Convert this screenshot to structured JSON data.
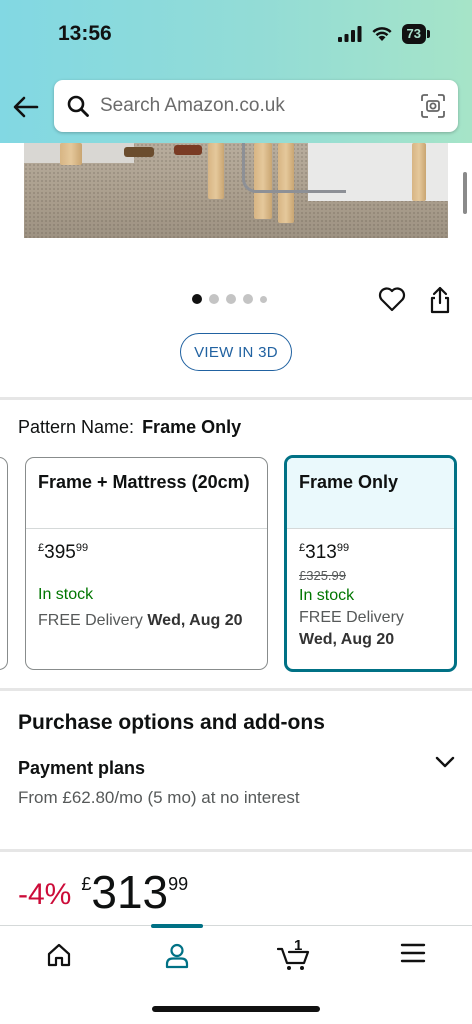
{
  "status_bar": {
    "time": "13:56",
    "battery": "73"
  },
  "search": {
    "placeholder": "Search Amazon.co.uk"
  },
  "gallery": {
    "dots": 5,
    "active_index": 0
  },
  "view3d_label": "VIEW IN 3D",
  "pattern": {
    "label": "Pattern Name:",
    "value": "Frame Only"
  },
  "options": [
    {
      "title": "Frame + Mattress (20cm)",
      "currency": "£",
      "price_whole": "395",
      "price_frac": "99",
      "stock": "In stock",
      "delivery_prefix": "FREE Delivery",
      "delivery_date": "Wed, Aug 20"
    },
    {
      "title": "Frame Only",
      "currency": "£",
      "price_whole": "313",
      "price_frac": "99",
      "was_price": "£325.99",
      "stock": "In stock",
      "delivery_prefix": "FREE Delivery",
      "delivery_date": "Wed, Aug 20",
      "selected": true
    }
  ],
  "purchase": {
    "title": "Purchase options and add-ons",
    "payment_title": "Payment plans",
    "payment_text": "From £62.80/mo (5 mo) at no interest"
  },
  "price_block": {
    "discount": "-4%",
    "currency": "£",
    "whole": "313",
    "frac": "99"
  },
  "nav": {
    "cart_count": "1",
    "active": "account"
  },
  "colors": {
    "accent": "#007185",
    "link": "#2162a1",
    "stock": "#007600",
    "discount": "#cc0c39"
  }
}
